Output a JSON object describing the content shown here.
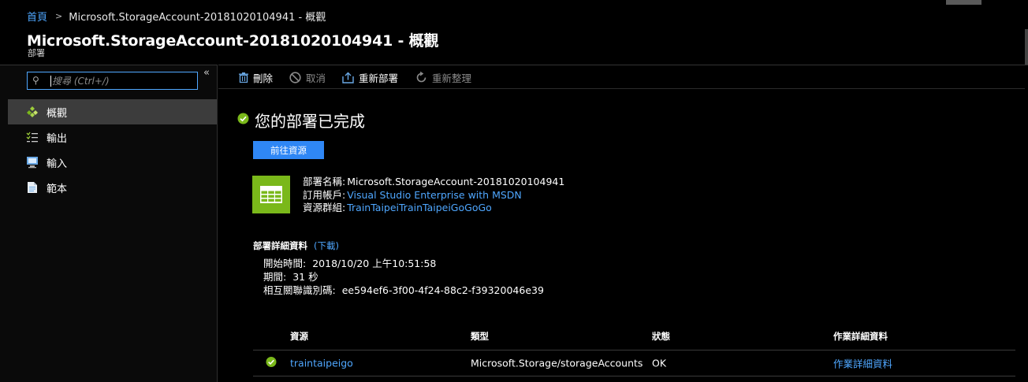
{
  "breadcrumb": {
    "home": "首頁",
    "current": "Microsoft.StorageAccount-20181020104941 - 概觀"
  },
  "header": {
    "title": "Microsoft.StorageAccount-20181020104941 - 概觀",
    "subtitle": "部署"
  },
  "sidebar": {
    "search_placeholder": "搜尋 (Ctrl+/)",
    "collapse_label": "«",
    "items": [
      {
        "label": "概觀",
        "icon": "overview-icon",
        "active": true
      },
      {
        "label": "輸出",
        "icon": "outputs-icon",
        "active": false
      },
      {
        "label": "輸入",
        "icon": "inputs-icon",
        "active": false
      },
      {
        "label": "範本",
        "icon": "template-icon",
        "active": false
      }
    ]
  },
  "toolbar": {
    "delete": "刪除",
    "cancel": "取消",
    "redeploy": "重新部署",
    "refresh": "重新整理"
  },
  "status": {
    "message": "您的部署已完成",
    "go_to_resource": "前往資源"
  },
  "deployment": {
    "name_label": "部署名稱:",
    "name": "Microsoft.StorageAccount-20181020104941",
    "subscription_label": "訂用帳戶:",
    "subscription": "Visual Studio Enterprise with MSDN",
    "resource_group_label": "資源群組:",
    "resource_group": "TrainTaipeiTrainTaipeiGoGoGo"
  },
  "details": {
    "heading": "部署詳細資料",
    "download": "(下載)",
    "start_label": "開始時間:",
    "start_time": "2018/10/20 上午10:51:58",
    "duration_label": "期間:",
    "duration": "31 秒",
    "correlation_label": "相互關聯識別碼:",
    "correlation_id": "ee594ef6-3f00-4f24-88c2-f39320046e39"
  },
  "table": {
    "headers": {
      "resource": "資源",
      "type": "類型",
      "status": "狀態",
      "op_details": "作業詳細資料"
    },
    "rows": [
      {
        "resource": "traintaipeigo",
        "type": "Microsoft.Storage/storageAccounts",
        "status": "OK",
        "op_details": "作業詳細資料"
      }
    ]
  },
  "colors": {
    "accent": "#2f87f5",
    "link": "#4fa7ff",
    "success": "#7ab81a"
  }
}
